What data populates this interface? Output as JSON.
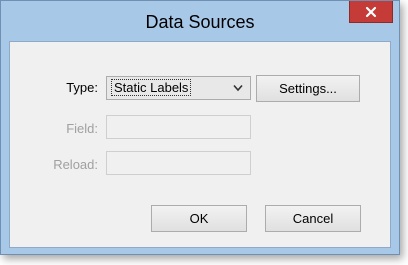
{
  "dialog": {
    "title": "Data Sources",
    "close_icon": "close-icon"
  },
  "form": {
    "type_label": "Type:",
    "type_value": "Static Labels",
    "settings_label": "Settings...",
    "field_label": "Field:",
    "field_value": "",
    "reload_label": "Reload:",
    "reload_value": ""
  },
  "buttons": {
    "ok": "OK",
    "cancel": "Cancel"
  },
  "colors": {
    "frame": "#a8c8e8",
    "close_button": "#c43b37",
    "client_area": "#f0f0f0"
  }
}
